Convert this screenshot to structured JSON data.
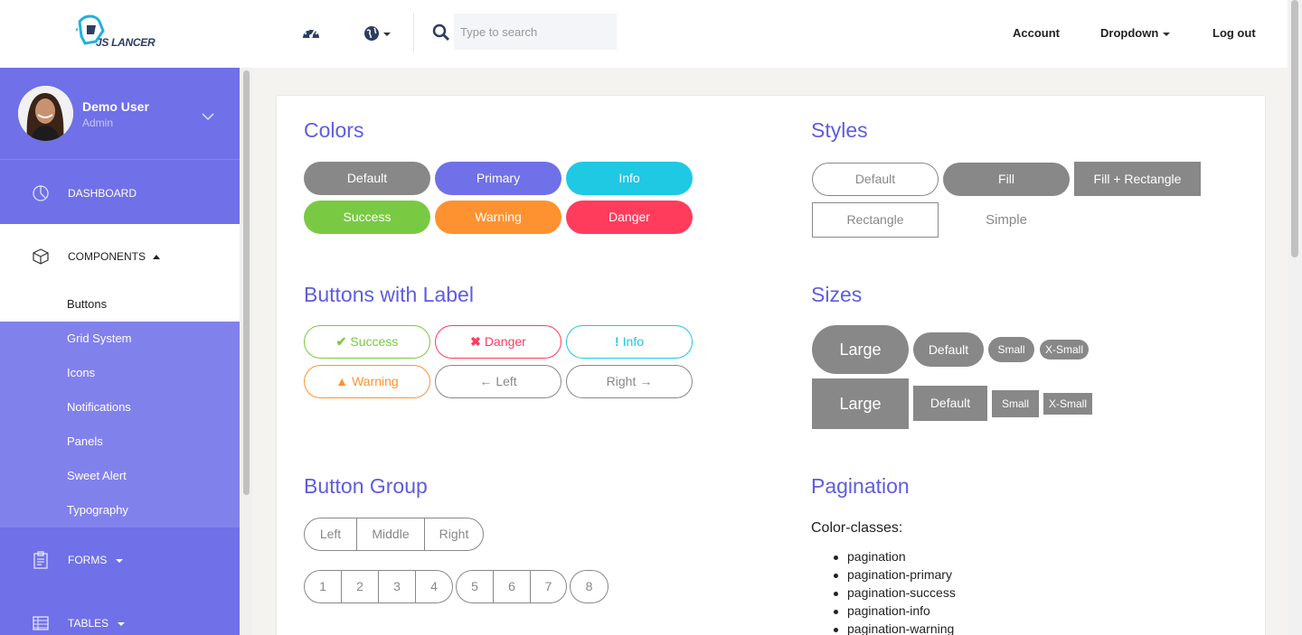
{
  "header": {
    "logo_text": "JS LANCER",
    "search_placeholder": "Type to search",
    "nav": {
      "account": "Account",
      "dropdown": "Dropdown",
      "logout": "Log out"
    }
  },
  "sidebar": {
    "user": {
      "name": "Demo User",
      "role": "Admin"
    },
    "dashboard": "DASHBOARD",
    "components": "COMPONENTS",
    "sub_items": [
      "Buttons",
      "Grid System",
      "Icons",
      "Notifications",
      "Panels",
      "Sweet Alert",
      "Typography"
    ],
    "forms": "FORMS",
    "tables": "TABLES"
  },
  "colors": {
    "title": "Colors",
    "buttons": [
      {
        "label": "Default",
        "color": "#888888"
      },
      {
        "label": "Primary",
        "color": "#7070e8"
      },
      {
        "label": "Info",
        "color": "#1fc8e3"
      },
      {
        "label": "Success",
        "color": "#7ac943"
      },
      {
        "label": "Warning",
        "color": "#ff9230"
      },
      {
        "label": "Danger",
        "color": "#ff3c5c"
      }
    ]
  },
  "styles": {
    "title": "Styles",
    "default": "Default",
    "fill": "Fill",
    "fill_rect": "Fill + Rectangle",
    "rectangle": "Rectangle",
    "simple": "Simple"
  },
  "labels": {
    "title": "Buttons with Label",
    "buttons": [
      {
        "label": "Success",
        "icon": "check-icon",
        "glyph": "✔",
        "color": "#7ac943"
      },
      {
        "label": "Danger",
        "icon": "times-icon",
        "glyph": "✖",
        "color": "#ff3c5c"
      },
      {
        "label": "Info",
        "icon": "exclamation-icon",
        "glyph": "!",
        "color": "#1fc8e3"
      },
      {
        "label": "Warning",
        "icon": "warning-icon",
        "glyph": "▲",
        "color": "#ff9230"
      },
      {
        "label": "Left",
        "icon": "arrow-left-icon",
        "glyph": "←",
        "color": "#888888"
      },
      {
        "label": "Right",
        "icon": "arrow-right-icon",
        "glyph": "→",
        "color": "#888888"
      }
    ]
  },
  "sizes": {
    "title": "Sizes",
    "large": "Large",
    "default": "Default",
    "small": "Small",
    "xsmall": "X-Small"
  },
  "button_group": {
    "title": "Button Group",
    "group1": [
      "Left",
      "Middle",
      "Right"
    ],
    "group2a": [
      "1",
      "2",
      "3",
      "4"
    ],
    "group2b": [
      "5",
      "6",
      "7"
    ],
    "group2c": [
      "8"
    ]
  },
  "pagination": {
    "title": "Pagination",
    "subtitle": "Color-classes:",
    "items": [
      "pagination",
      "pagination-primary",
      "pagination-success",
      "pagination-info",
      "pagination-warning"
    ]
  }
}
